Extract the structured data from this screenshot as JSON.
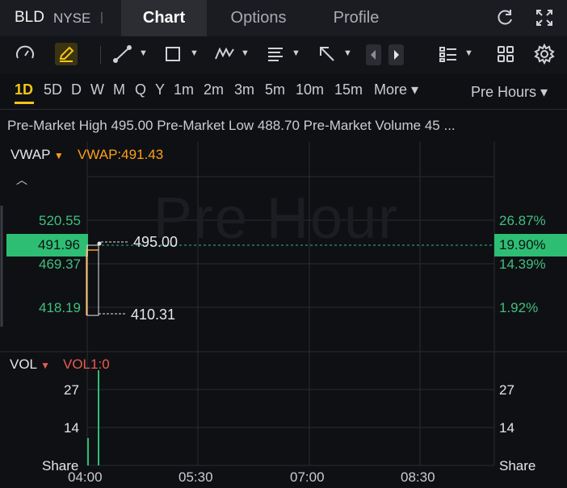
{
  "header": {
    "ticker": "BLD",
    "exchange": "NYSE",
    "separator": "|",
    "tabs": [
      "Chart",
      "Options",
      "Profile"
    ],
    "active_tab": "Chart"
  },
  "toolbar": {
    "icons": [
      "gauge-icon",
      "pencil-icon",
      "trendline-icon",
      "rectangle-icon",
      "pattern-icon",
      "text-icon",
      "arrow-icon",
      "prev-icon",
      "next-icon",
      "layout-icon",
      "grid-icon",
      "settings-icon"
    ]
  },
  "periods": [
    "1D",
    "5D",
    "D",
    "W",
    "M",
    "Q",
    "Y",
    "1m",
    "2m",
    "3m",
    "5m",
    "10m",
    "15m",
    "More ▾"
  ],
  "selected_period": "1D",
  "session": "Pre Hours ▾",
  "info_line": "Pre-Market High 495.00 Pre-Market Low 488.70 Pre-Market Volume 45 ...",
  "price_panel": {
    "indicator": "VWAP",
    "indicator_value": "VWAP:491.43",
    "watermark": "Pre Hour",
    "y_labels_left": [
      "520.55",
      "469.37",
      "418.19"
    ],
    "current_price": "491.96",
    "y_labels_right": [
      "26.87%",
      "14.39%",
      "1.92%"
    ],
    "current_pct": "19.90%",
    "high_annotation": "495.00",
    "low_annotation": "410.31"
  },
  "volume_panel": {
    "indicator": "VOL",
    "indicator_value": "VOL1:0",
    "left_labels": [
      "27",
      "14",
      "Share"
    ],
    "right_labels": [
      "27",
      "14",
      "Share"
    ]
  },
  "time_axis": [
    "04:00",
    "05:30",
    "07:00",
    "08:30"
  ],
  "colors": {
    "accent": "#f5c518",
    "up": "#2dbe74",
    "vwap": "#ff9f1a",
    "vol": "#e85d4f"
  }
}
